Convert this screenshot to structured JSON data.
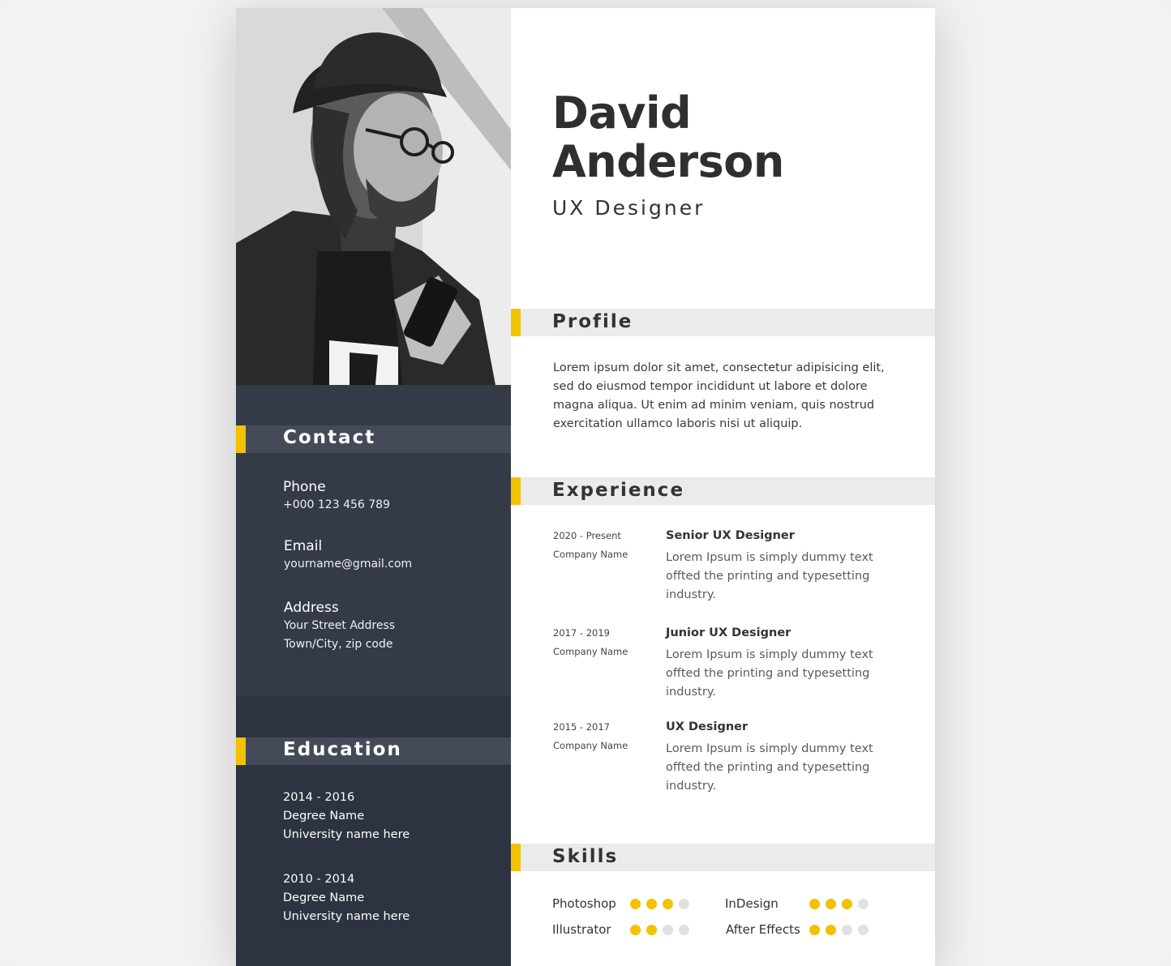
{
  "theme": {
    "accent": "#f2c100",
    "dark_panel": "#2d3340",
    "contact_panel": "#353a47"
  },
  "header": {
    "first_name": "David",
    "last_name": "Anderson",
    "role": "UX Designer"
  },
  "contact": {
    "title": "Contact",
    "items": [
      {
        "label": "Phone",
        "lines": [
          "+000 123 456 789"
        ]
      },
      {
        "label": "Email",
        "lines": [
          "yourname@gmail.com"
        ]
      },
      {
        "label": "Address",
        "lines": [
          "Your Street Address",
          "Town/City, zip code"
        ]
      }
    ]
  },
  "education": {
    "title": "Education",
    "items": [
      {
        "years": "2014 - 2016",
        "degree": "Degree Name",
        "school": "University name here"
      },
      {
        "years": "2010 - 2014",
        "degree": "Degree Name",
        "school": "University name here"
      }
    ]
  },
  "profile": {
    "title": "Profile",
    "text": "Lorem ipsum dolor sit amet, consectetur adipisicing elit, sed do eiusmod tempor incididunt ut labore et dolore magna aliqua. Ut enim ad minim veniam, quis nostrud exercitation ullamco laboris nisi ut aliquip."
  },
  "experience": {
    "title": "Experience",
    "items": [
      {
        "dates": "2020 - Present",
        "company": "Company Name",
        "title": "Senior UX Designer",
        "description": "Lorem Ipsum is simply dummy text offted the printing and typesetting industry."
      },
      {
        "dates": "2017 - 2019",
        "company": "Company Name",
        "title": "Junior UX Designer",
        "description": "Lorem Ipsum is simply dummy text offted the printing and typesetting industry."
      },
      {
        "dates": "2015 - 2017",
        "company": "Company Name",
        "title": "UX Designer",
        "description": "Lorem Ipsum is simply dummy text offted the printing and typesetting industry."
      }
    ]
  },
  "skills": {
    "title": "Skills",
    "max_level": 4,
    "items": [
      {
        "name": "Photoshop",
        "level": 3
      },
      {
        "name": "InDesign",
        "level": 3
      },
      {
        "name": "Illustrator",
        "level": 2
      },
      {
        "name": "After Effects",
        "level": 2
      }
    ]
  }
}
